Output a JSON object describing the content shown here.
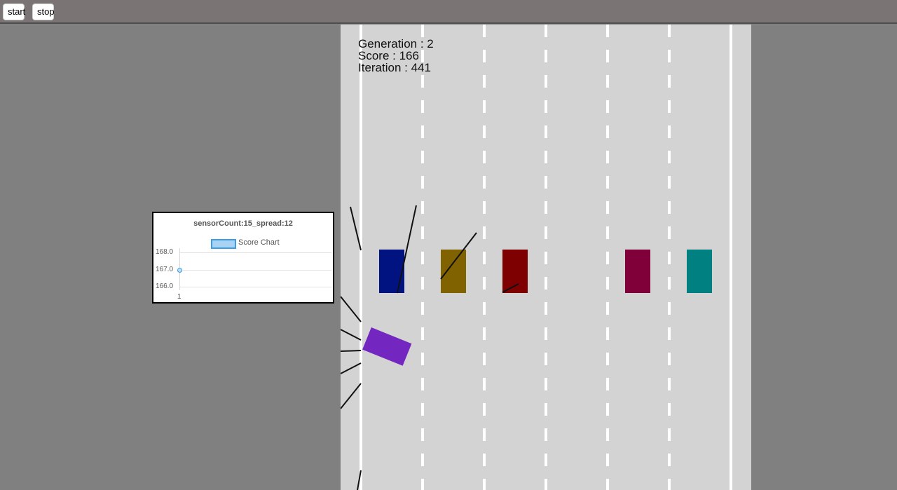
{
  "toolbar": {
    "start_label": "start",
    "stop_label": "stop"
  },
  "hud": {
    "generation": "Generation : 2",
    "score": "Score : 166",
    "iteration": "Iteration : 441"
  },
  "colors": {
    "background": "#808080",
    "road": "#d3d3d3",
    "player_car": "#7326c0",
    "traffic": [
      "#001380",
      "#806300",
      "#7f0000",
      "#80003a",
      "#008080"
    ]
  },
  "chart_data": {
    "type": "line",
    "title": "sensorCount:15_spread:12",
    "legend": "top",
    "grid": true,
    "series": [
      {
        "name": "Score Chart",
        "color": "#3a9ee2",
        "values": [
          167
        ]
      }
    ],
    "x": [
      "1"
    ],
    "y_ticks": [
      "168.0",
      "167.0",
      "166.0"
    ],
    "ylim": [
      166,
      168
    ]
  }
}
